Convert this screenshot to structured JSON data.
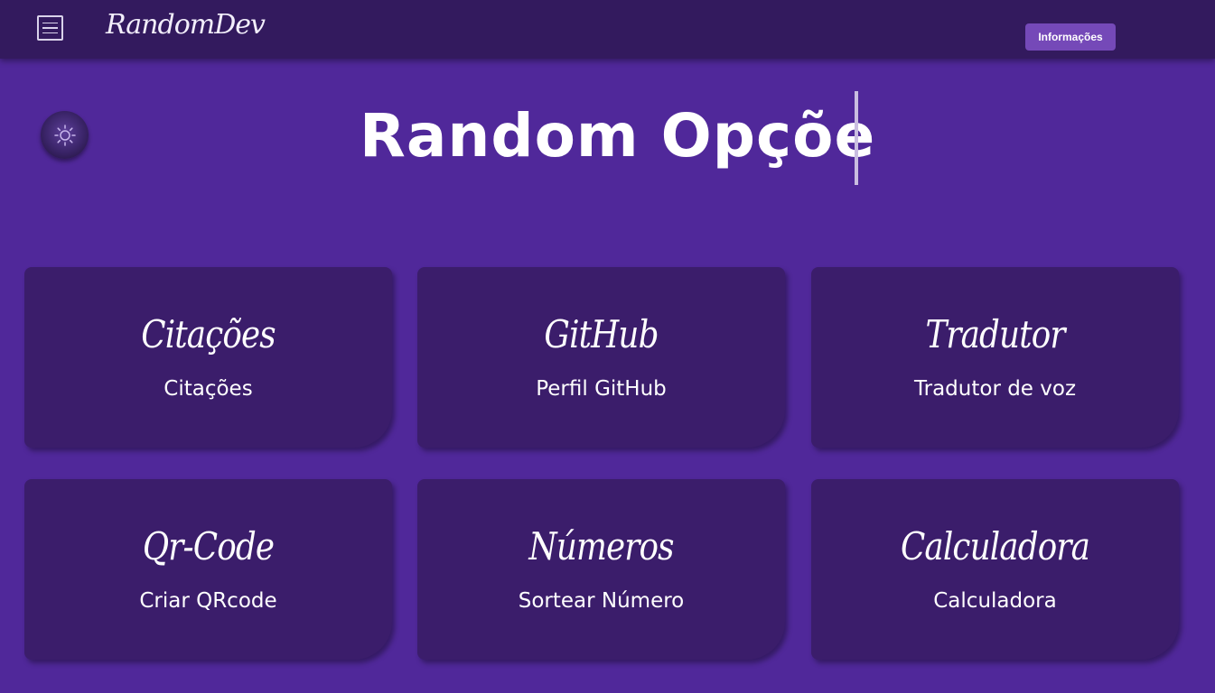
{
  "header": {
    "logo": "RandomDev",
    "info_button": "Informações",
    "menu_icon": "hamburger-menu-icon"
  },
  "hero": {
    "title": "Random Opçõe",
    "theme_icon": "sun-icon"
  },
  "cards": [
    {
      "script": "Citações",
      "label": "Citações"
    },
    {
      "script": "GitHub",
      "label": "Perfil GitHub"
    },
    {
      "script": "Tradutor",
      "label": "Tradutor de voz"
    },
    {
      "script": "Qr-Code",
      "label": "Criar QRcode"
    },
    {
      "script": "Números",
      "label": "Sortear Número"
    },
    {
      "script": "Calculadora",
      "label": "Calculadora"
    }
  ],
  "colors": {
    "background": "#50289a",
    "topbar": "#331a5e",
    "card": "#3b1d6b",
    "button": "#7549b8"
  }
}
